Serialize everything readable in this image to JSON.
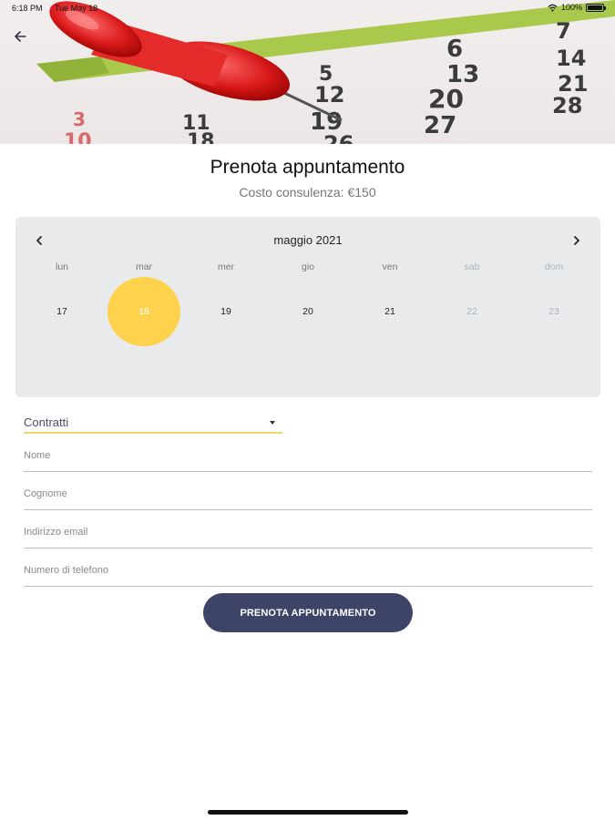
{
  "status_bar": {
    "time": "6:18 PM",
    "date": "Tue May 18",
    "battery": "100%"
  },
  "header": {
    "back_icon": "arrow-left-icon",
    "hero_image": "calendar-pushpin"
  },
  "title": "Prenota appuntamento",
  "subtitle": "Costo consulenza: €150",
  "calendar": {
    "month_label": "maggio 2021",
    "prev_icon": "chevron-left-icon",
    "next_icon": "chevron-right-icon",
    "weekdays": [
      "lun",
      "mar",
      "mer",
      "gio",
      "ven",
      "sab",
      "dom"
    ],
    "days": [
      "17",
      "18",
      "19",
      "20",
      "21",
      "22",
      "23"
    ],
    "selected_day": "18",
    "selected_color": "#ffd24d",
    "weekend_color": "#aab4c0"
  },
  "form": {
    "select_value": "Contratti",
    "name_placeholder": "Nome",
    "surname_placeholder": "Cognome",
    "email_placeholder": "Indirizzo email",
    "phone_placeholder": "Numero di telefono",
    "submit_label": "PRENOTA APPUNTAMENTO",
    "submit_color": "#3d4468"
  }
}
